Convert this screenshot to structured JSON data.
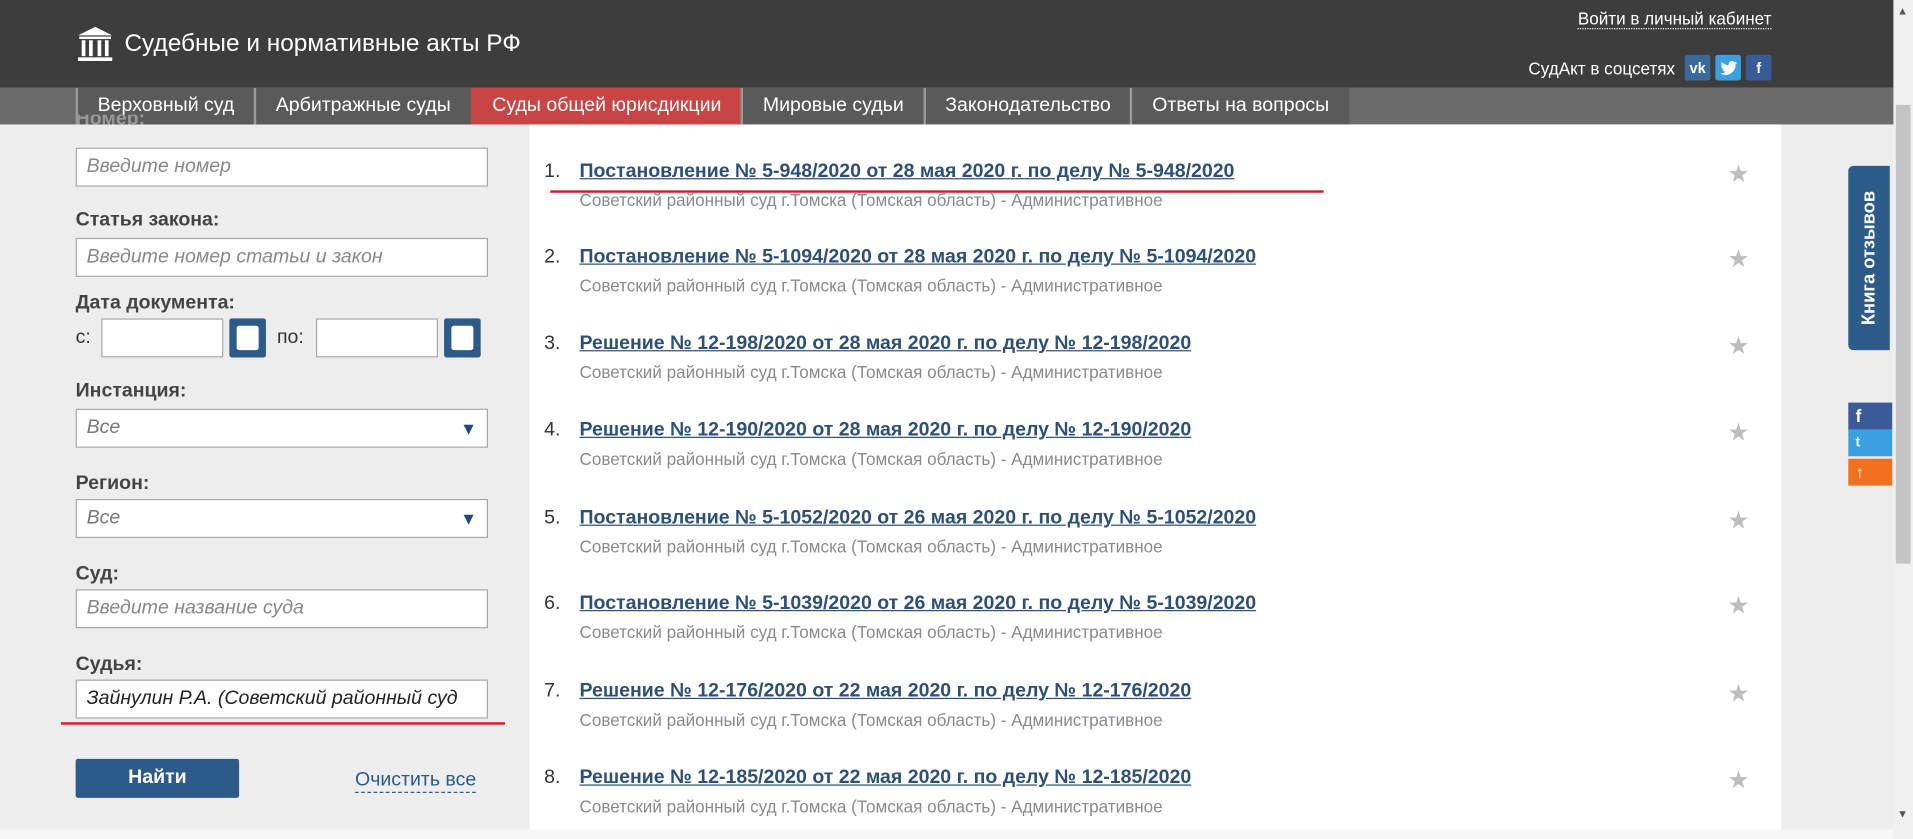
{
  "header": {
    "site_title": "Судебные и нормативные акты РФ",
    "login_link": "Войти в личный кабинет",
    "social_label": "СудАкт в соцсетях",
    "social_icons": [
      "vk-icon",
      "twitter-icon",
      "facebook-icon"
    ]
  },
  "nav": {
    "tabs": [
      {
        "label": "Верховный суд",
        "active": false
      },
      {
        "label": "Арбитражные суды",
        "active": false
      },
      {
        "label": "Суды общей юрисдикции",
        "active": true
      },
      {
        "label": "Мировые судьи",
        "active": false
      },
      {
        "label": "Законодательство",
        "active": false
      },
      {
        "label": "Ответы на вопросы",
        "active": false
      }
    ]
  },
  "filters": {
    "number_label": "Номер:",
    "number_placeholder": "Введите номер",
    "law_label": "Статья закона:",
    "law_placeholder": "Введите номер статьи и закон",
    "date_label": "Дата документа:",
    "date_from": "с:",
    "date_to": "по:",
    "instance_label": "Инстанция:",
    "instance_value": "Все",
    "region_label": "Регион:",
    "region_value": "Все",
    "court_label": "Суд:",
    "court_placeholder": "Введите название суда",
    "judge_label": "Судья:",
    "judge_value": "Зайнулин Р.А. (Советский районный суд",
    "find_button": "Найти",
    "clear_link": "Очистить все"
  },
  "results": [
    {
      "num": "1.",
      "title": "Постановление № 5-948/2020 от 28 мая 2020 г. по делу № 5-948/2020",
      "sub": "Советский районный суд г.Томска (Томская область) - Административное"
    },
    {
      "num": "2.",
      "title": "Постановление № 5-1094/2020 от 28 мая 2020 г. по делу № 5-1094/2020",
      "sub": "Советский районный суд г.Томска (Томская область) - Административное"
    },
    {
      "num": "3.",
      "title": "Решение № 12-198/2020 от 28 мая 2020 г. по делу № 12-198/2020",
      "sub": "Советский районный суд г.Томска (Томская область) - Административное"
    },
    {
      "num": "4.",
      "title": "Решение № 12-190/2020 от 28 мая 2020 г. по делу № 12-190/2020",
      "sub": "Советский районный суд г.Томска (Томская область) - Административное"
    },
    {
      "num": "5.",
      "title": "Постановление № 5-1052/2020 от 26 мая 2020 г. по делу № 5-1052/2020",
      "sub": "Советский районный суд г.Томска (Томская область) - Административное"
    },
    {
      "num": "6.",
      "title": "Постановление № 5-1039/2020 от 26 мая 2020 г. по делу № 5-1039/2020",
      "sub": "Советский районный суд г.Томска (Томская область) - Административное"
    },
    {
      "num": "7.",
      "title": "Решение № 12-176/2020 от 22 мая 2020 г. по делу № 12-176/2020",
      "sub": "Советский районный суд г.Томска (Томская область) - Административное"
    },
    {
      "num": "8.",
      "title": "Решение № 12-185/2020 от 22 мая 2020 г. по делу № 12-185/2020",
      "sub": "Советский районный суд г.Томска (Томская область) - Административное"
    }
  ],
  "side": {
    "feedback_tab": "Книга отзывов"
  },
  "colors": {
    "header_bg": "#3d3d3d",
    "active_tab": "#c94444",
    "accent_blue": "#2c5b8a",
    "link_color": "#2c5078",
    "highlight_red": "#d02020"
  }
}
